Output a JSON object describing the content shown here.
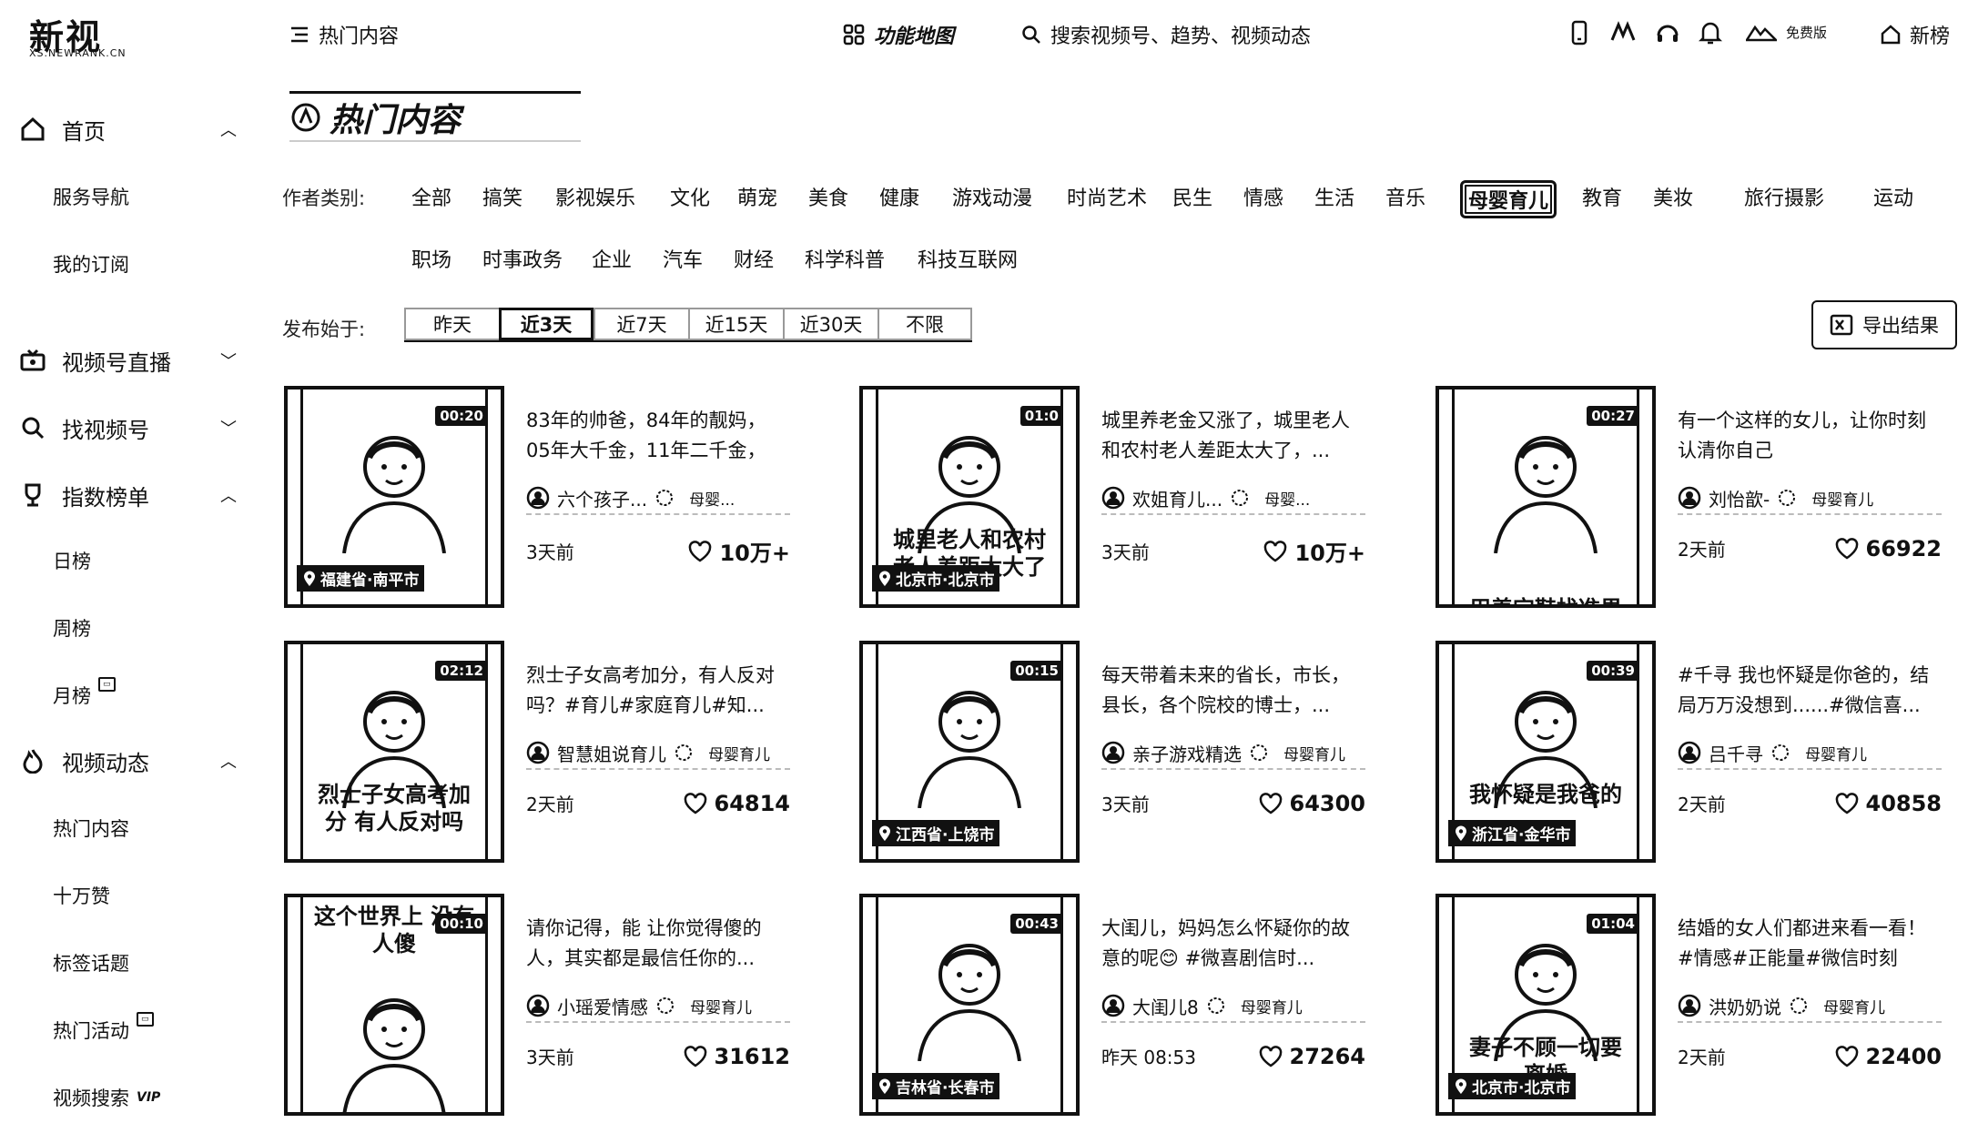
{
  "brand": {
    "name": "新视",
    "domain": "XS.NEWRANK.CN"
  },
  "topbar": {
    "menu_label": "热门内容",
    "feature_map": "功能地图",
    "search_placeholder": "搜索视频号、趋势、视频动态",
    "free_version": "免费版",
    "xinbang": "新榜"
  },
  "sidebar": {
    "home": "首页",
    "service_nav": "服务导航",
    "my_subs": "我的订阅",
    "live": "视频号直播",
    "find": "找视频号",
    "index": "指数榜单",
    "daily": "日榜",
    "weekly": "周榜",
    "monthly": "月榜",
    "dynamics": "视频动态",
    "hot": "热门内容",
    "hundred_k": "十万赞",
    "tags": "标签话题",
    "events": "热门活动",
    "video_search": "视频搜索",
    "vip": "VIP"
  },
  "page_title": "热门内容",
  "filters": {
    "author_label": "作者类别:",
    "categories_row1": [
      "全部",
      "搞笑",
      "影视娱乐",
      "文化",
      "萌宠",
      "美食",
      "健康",
      "游戏动漫",
      "时尚艺术",
      "民生",
      "情感",
      "生活",
      "音乐",
      "母婴育儿",
      "教育",
      "美妆",
      "旅行摄影",
      "运动"
    ],
    "categories_row2": [
      "职场",
      "时事政务",
      "企业",
      "汽车",
      "财经",
      "科学科普",
      "科技互联网"
    ],
    "active_category": "母婴育儿",
    "date_label": "发布始于:",
    "date_options": [
      "昨天",
      "近3天",
      "近7天",
      "近15天",
      "近30天",
      "不限"
    ],
    "active_date": "近3天",
    "export_label": "导出结果"
  },
  "cards": [
    {
      "duration": "00:20",
      "location": "福建省·南平市",
      "caption": "",
      "title": "83年的帅爸，84年的靓妈，05年大千金，11年二千金，1...",
      "author": "六个孩子...",
      "category": "母婴...",
      "time": "3天前",
      "likes": "10万+"
    },
    {
      "duration": "01:0",
      "location": "北京市·北京市",
      "caption": "城里老人和农村老人差距太大了",
      "title": "城里养老金又涨了，城里老人和农村老人差距太大了，...",
      "author": "欢姐育儿...",
      "category": "母婴...",
      "time": "3天前",
      "likes": "10万+"
    },
    {
      "duration": "00:27",
      "location": "",
      "caption": "用养宝鞋找准果",
      "title": "有一个这样的女儿，让你时刻认清你自己",
      "author": "刘怡歆-",
      "category": "母婴育儿",
      "time": "2天前",
      "likes": "66922"
    },
    {
      "duration": "02:12",
      "location": "",
      "caption": "烈士子女高考加分 有人反对吗",
      "title": "烈士子女高考加分，有人反对吗？#育儿#家庭育儿#知...",
      "author": "智慧姐说育儿",
      "category": "母婴育儿",
      "time": "2天前",
      "likes": "64814"
    },
    {
      "duration": "00:15",
      "location": "江西省·上饶市",
      "caption": "",
      "title": "每天带着未来的省长，市长，县长，各个院校的博士，...",
      "author": "亲子游戏精选",
      "category": "母婴育儿",
      "time": "3天前",
      "likes": "64300"
    },
    {
      "duration": "00:39",
      "location": "浙江省·金华市",
      "caption": "我怀疑是我爸的",
      "title": "#千寻 我也怀疑是你爸的，结局万万没想到......#微信喜...",
      "author": "吕千寻",
      "category": "母婴育儿",
      "time": "2天前",
      "likes": "40858"
    },
    {
      "duration": "00:10",
      "location": "",
      "caption": "这个世界上 没有人傻",
      "title": "请你记得，能 让你觉得傻的人，其实都是最信任你的...",
      "author": "小瑶爱情感",
      "category": "母婴育儿",
      "time": "3天前",
      "likes": "31612"
    },
    {
      "duration": "00:43",
      "location": "吉林省·长春市",
      "caption": "",
      "title": "大闺儿，妈妈怎么怀疑你的故意的呢😊 #微喜剧信时...",
      "author": "大闺儿8",
      "category": "母婴育儿",
      "time": "昨天 08:53",
      "likes": "27264"
    },
    {
      "duration": "01:04",
      "location": "北京市·北京市",
      "caption": "妻子不顾一切要离婚",
      "title": "结婚的女人们都进来看一看！#情感#正能量#微信时刻",
      "author": "洪奶奶说",
      "category": "母婴育儿",
      "time": "2天前",
      "likes": "22400"
    }
  ]
}
